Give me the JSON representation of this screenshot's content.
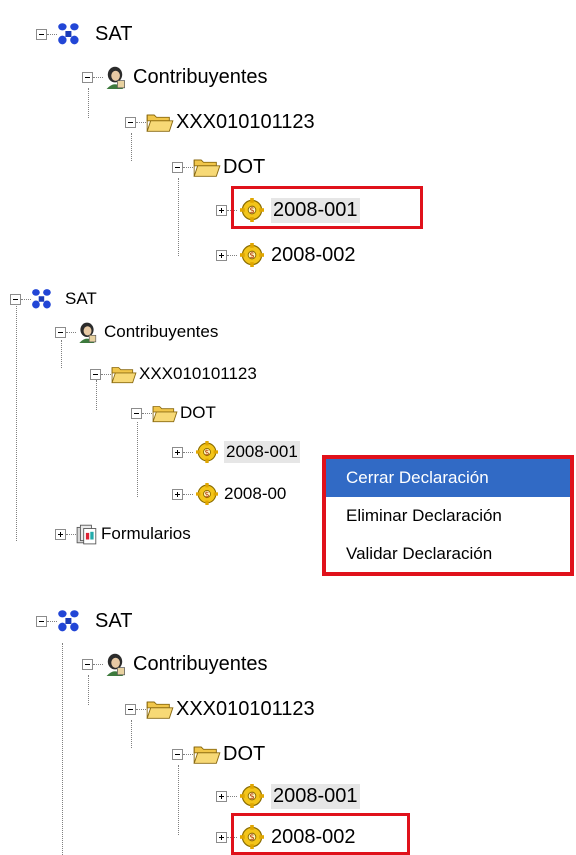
{
  "colors": {
    "highlight": "#316ac5",
    "annotation": "#e0111b",
    "selection": "#e6e6e6"
  },
  "panels": [
    {
      "root": "SAT",
      "contribuyentes": "Contribuyentes",
      "rfc": "XXX010101123",
      "dot": "DOT",
      "decl1": "2008-001",
      "decl2": "2008-002"
    },
    {
      "root": "SAT",
      "contribuyentes": "Contribuyentes",
      "rfc": "XXX010101123",
      "dot": "DOT",
      "decl1": "2008-001",
      "decl2": "2008-00",
      "formularios": "Formularios"
    },
    {
      "root": "SAT",
      "contribuyentes": "Contribuyentes",
      "rfc": "XXX010101123",
      "dot": "DOT",
      "decl1": "2008-001",
      "decl2": "2008-002"
    }
  ],
  "context_menu": {
    "items": [
      "Cerrar Declaración",
      "Eliminar Declaración",
      "Validar Declaración"
    ],
    "highlighted": "Cerrar Declaración"
  },
  "icons": {
    "sat": "sat-logo-icon",
    "user": "user-icon",
    "folder": "open-folder-icon",
    "gear": "gear-icon",
    "form": "form-icon"
  }
}
